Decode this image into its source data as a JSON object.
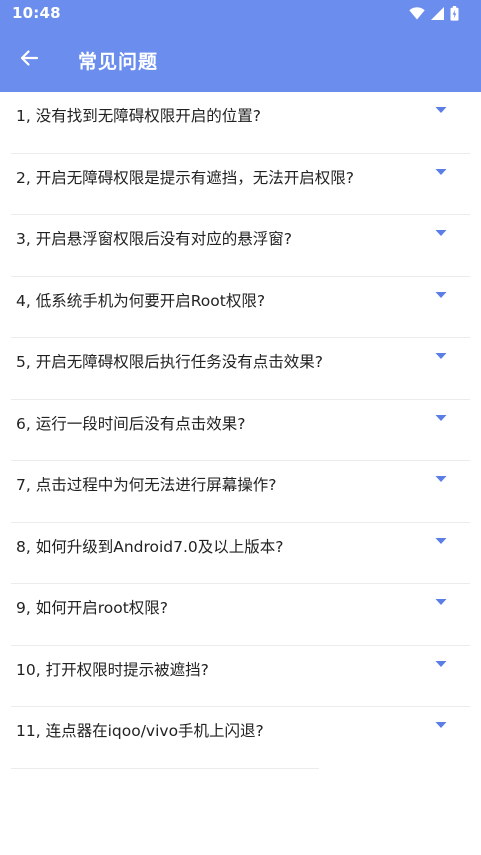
{
  "status_bar": {
    "time": "10:48",
    "icons": [
      "wifi-icon",
      "signal-icon",
      "battery-icon"
    ]
  },
  "app_bar": {
    "back_icon": "arrow-left-icon",
    "title": "常见问题"
  },
  "colors": {
    "primary": "#6b8ded",
    "text": "#222222",
    "divider": "#ececec",
    "chevron": "#5a7ee6"
  },
  "faq": {
    "expand_icon": "caret-down-icon",
    "items": [
      {
        "question": "1, 没有找到无障碍权限开启的位置?"
      },
      {
        "question": "2, 开启无障碍权限是提示有遮挡，无法开启权限?"
      },
      {
        "question": "3, 开启悬浮窗权限后没有对应的悬浮窗?"
      },
      {
        "question": "4, 低系统手机为何要开启Root权限?"
      },
      {
        "question": "5, 开启无障碍权限后执行任务没有点击效果?"
      },
      {
        "question": "6, 运行一段时间后没有点击效果?"
      },
      {
        "question": "7, 点击过程中为何无法进行屏幕操作?"
      },
      {
        "question": "8, 如何升级到Android7.0及以上版本?"
      },
      {
        "question": "9, 如何开启root权限?"
      },
      {
        "question": "10, 打开权限时提示被遮挡?"
      },
      {
        "question": "11, 连点器在iqoo/vivo手机上闪退?"
      }
    ]
  }
}
